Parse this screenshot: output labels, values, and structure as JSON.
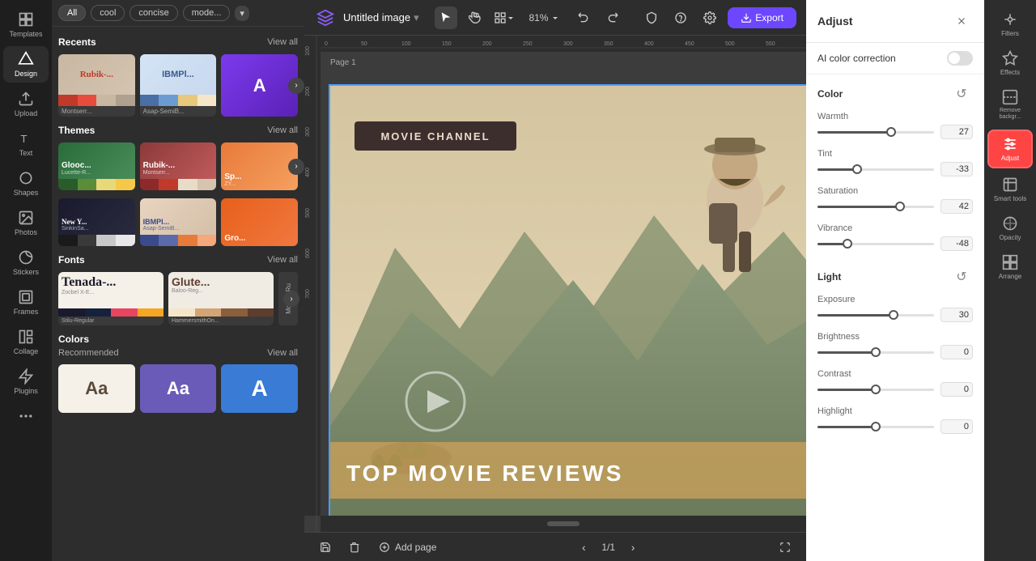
{
  "app": {
    "logo": "✦",
    "doc_title": "Untitled image",
    "doc_title_arrow": "▾"
  },
  "toolbar": {
    "zoom_level": "81%",
    "undo_icon": "↩",
    "redo_icon": "↪",
    "export_label": "Export",
    "select_tool": "▲",
    "hand_tool": "✋",
    "view_tool": "⊞",
    "grid_tool": "⊞",
    "shield_icon": "🛡",
    "help_icon": "?",
    "settings_icon": "⚙"
  },
  "canvas": {
    "page_label": "Page 1",
    "add_page_label": "Add page",
    "page_nav": "1/1"
  },
  "left_sidebar": {
    "items": [
      {
        "label": "Templates",
        "icon": "grid"
      },
      {
        "label": "Design",
        "icon": "diamond",
        "active": true
      },
      {
        "label": "Upload",
        "icon": "upload"
      },
      {
        "label": "Text",
        "icon": "T"
      },
      {
        "label": "Shapes",
        "icon": "shapes"
      },
      {
        "label": "Photos",
        "icon": "photo"
      },
      {
        "label": "Stickers",
        "icon": "sticker"
      },
      {
        "label": "Frames",
        "icon": "frame"
      },
      {
        "label": "Collage",
        "icon": "collage"
      },
      {
        "label": "Plugins",
        "icon": "plugin"
      },
      {
        "label": "More",
        "icon": "more"
      }
    ]
  },
  "panel": {
    "tags": [
      "All",
      "cool",
      "concise",
      "mode..."
    ],
    "tag_more": "▾",
    "sections": {
      "recents": {
        "title": "Recents",
        "view_all": "View all",
        "cards": [
          {
            "name": "Rubik-...",
            "sub": "Montserr...",
            "bg": "#c0392b",
            "colors": [
              "#c0392b",
              "#e74c3c",
              "#c8b8a2",
              "#b0a090"
            ]
          },
          {
            "name": "IBMPl...",
            "sub": "Asap-SemiB...",
            "bg": "#3a5a8c",
            "colors": [
              "#4a6fa5",
              "#6c9bd2",
              "#e8c87a",
              "#f5e6c8"
            ]
          },
          {
            "name": "A",
            "bg": "#7c3aed",
            "partial": true
          }
        ]
      },
      "themes": {
        "title": "Themes",
        "view_all": "View all",
        "cards": [
          {
            "name": "Glooc...",
            "sub": "Lucette-R...",
            "bg_top": "#2a5c2a",
            "colors": [
              "#2a5c2a",
              "#5a8c3a",
              "#e8d87a",
              "#f5c84a"
            ]
          },
          {
            "name": "Rubik-...",
            "sub": "Montserr...",
            "bg_top": "#8c2a2a",
            "colors": [
              "#8c2a2a",
              "#c0392b",
              "#e8dcc8",
              "#d4c4b0"
            ]
          },
          {
            "name": "Sp... ZY...",
            "bg_top": "#e85a2a",
            "partial": true
          },
          {
            "name": "New Y...",
            "sub": "SinkinSa...",
            "bg_top": "#1a1a1a",
            "colors": [
              "#1a1a1a",
              "#3a3a3a",
              "#c8c8c8",
              "#e8e8e8"
            ]
          },
          {
            "name": "IBMPl...",
            "sub": "Asap-SemiB...",
            "bg_top": "#3a4a8c",
            "colors": [
              "#3a4a8c",
              "#5a6aac",
              "#e87a3a",
              "#f5a87a"
            ]
          },
          {
            "name": "Gro...",
            "bg_top": "#e85a1a",
            "partial": true
          }
        ]
      },
      "fonts": {
        "title": "Fonts",
        "view_all": "View all",
        "cards": [
          {
            "name": "Tenada-...",
            "sub": "Zocbel X-E...",
            "sub2": "Stilu-Regular",
            "font_display": "Te",
            "colors": [
              "#1a1a2e",
              "#16213e",
              "#e94560",
              "#f5a623"
            ]
          },
          {
            "name": "Glute...",
            "sub": "Baloo-Reg...",
            "sub2": "HammersmithOn...",
            "font_display": "Gl",
            "colors": [
              "#f5e6c8",
              "#d4a574",
              "#8b5e3c",
              "#5c3d2e"
            ]
          },
          {
            "name": "Ru",
            "sub": "Mor",
            "partial": true
          }
        ]
      },
      "colors": {
        "title": "Colors",
        "recommended": "Recommended",
        "view_all": "View all",
        "cards": [
          {
            "type": "warm",
            "bg": "#f5f0e8",
            "text": "Aa",
            "text_color": "#5a4a3a"
          },
          {
            "type": "purple",
            "bg": "#6b5bb8",
            "text": "Aa",
            "text_color": "#ffffff"
          },
          {
            "type": "blue",
            "bg": "#3a7bd5",
            "text": "A",
            "text_color": "#ffffff"
          }
        ]
      }
    }
  },
  "adjust_panel": {
    "title": "Adjust",
    "close_icon": "✕",
    "ai_color_correction": "AI color correction",
    "ai_toggle_on": false,
    "color_section": "Color",
    "reset_icon": "↺",
    "sliders": [
      {
        "name": "warmth",
        "label": "Warmth",
        "value": 27,
        "min": -100,
        "max": 100,
        "fill_pct": 63
      },
      {
        "name": "tint",
        "label": "Tint",
        "value": -33,
        "min": -100,
        "max": 100,
        "fill_pct": 34
      },
      {
        "name": "saturation",
        "label": "Saturation",
        "value": 42,
        "min": -100,
        "max": 100,
        "fill_pct": 71
      },
      {
        "name": "vibrance",
        "label": "Vibrance",
        "value": -48,
        "min": -100,
        "max": 100,
        "fill_pct": 26
      }
    ],
    "light_section": "Light",
    "light_sliders": [
      {
        "name": "exposure",
        "label": "Exposure",
        "value": 30,
        "min": -100,
        "max": 100,
        "fill_pct": 65
      },
      {
        "name": "brightness",
        "label": "Brightness",
        "value": 0,
        "min": -100,
        "max": 100,
        "fill_pct": 50
      },
      {
        "name": "contrast",
        "label": "Contrast",
        "value": 0,
        "min": -100,
        "max": 100,
        "fill_pct": 50
      },
      {
        "name": "highlight",
        "label": "Highlight",
        "value": 0,
        "min": -100,
        "max": 100,
        "fill_pct": 50
      }
    ]
  },
  "right_icon_bar": {
    "items": [
      {
        "label": "Filters",
        "icon": "filter"
      },
      {
        "label": "Effects",
        "icon": "effects"
      },
      {
        "label": "Remove backgr...",
        "icon": "remove-bg"
      },
      {
        "label": "Adjust",
        "icon": "adjust",
        "active": true
      },
      {
        "label": "Smart tools",
        "icon": "smart"
      },
      {
        "label": "Opacity",
        "icon": "opacity"
      },
      {
        "label": "Arrange",
        "icon": "arrange"
      }
    ]
  },
  "canvas_image": {
    "movie_channel": "MOVIE CHANNEL",
    "bottom_text": "TOP MOVIE REVIEWS",
    "play_button": "▶"
  }
}
